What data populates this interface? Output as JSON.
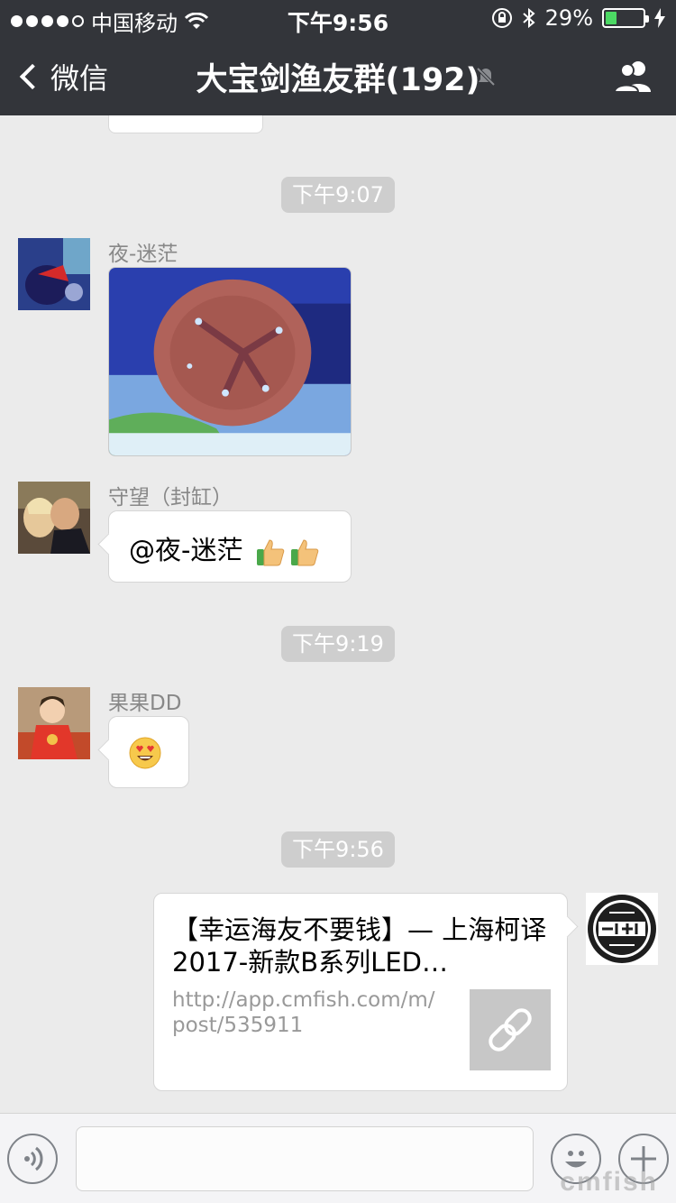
{
  "status_bar": {
    "carrier": "中国移动",
    "time": "下午9:56",
    "battery_percent": "29%",
    "battery_level": 0.29
  },
  "nav": {
    "back_label": "微信",
    "title": "大宝剑渔友群(192)"
  },
  "messages": [
    {
      "type": "timestamp",
      "text": "下午9:07"
    },
    {
      "type": "image",
      "sender": "夜-迷茫"
    },
    {
      "type": "text",
      "sender": "守望（封缸）",
      "text": "@夜-迷茫 ",
      "emoji": [
        "thumbs-up",
        "thumbs-up"
      ]
    },
    {
      "type": "timestamp",
      "text": "下午9:19"
    },
    {
      "type": "emoji",
      "sender": "果果DD",
      "emoji": "heart-eyes"
    },
    {
      "type": "timestamp",
      "text": "下午9:56"
    },
    {
      "type": "link",
      "from_self": true,
      "title": "【幸运海友不要钱】— 上海柯译2017-新款B系列LED…",
      "url": "http://app.cmfish.com/m/post/535911"
    }
  ],
  "watermark": "cmfish",
  "colors": {
    "nav_bg": "#33353a",
    "chat_bg": "#ebebeb",
    "timestamp_bg": "#cecece",
    "battery_fill": "#4cd964"
  }
}
